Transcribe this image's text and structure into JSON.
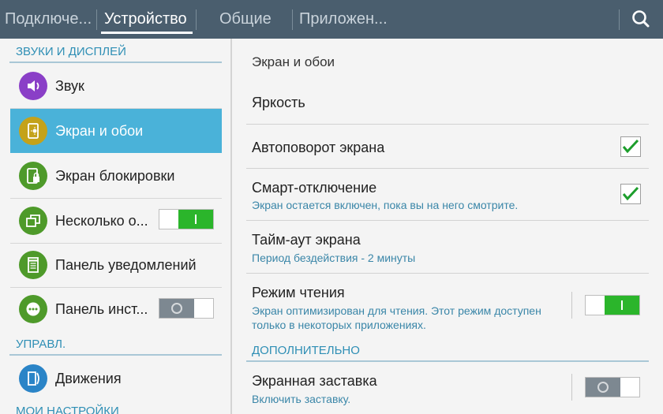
{
  "topbar": {
    "tabs": [
      {
        "label": "Подключе..."
      },
      {
        "label": "Устройство",
        "active": true
      },
      {
        "label": "Общие"
      },
      {
        "label": "Приложен..."
      }
    ],
    "search_icon": "search-icon"
  },
  "sidebar": {
    "sections": [
      {
        "header": "ЗВУКИ И ДИСПЛЕЙ"
      },
      {
        "header": "УПРАВЛ."
      },
      {
        "header": "МОИ НАСТРОЙКИ"
      }
    ],
    "items": [
      {
        "label": "Звук",
        "icon": "speaker-icon",
        "icon_color": "#8a3fc7"
      },
      {
        "label": "Экран и обои",
        "icon": "screen-brightness-icon",
        "icon_color": "#c4a21a",
        "selected": true
      },
      {
        "label": "Экран блокировки",
        "icon": "lock-screen-icon",
        "icon_color": "#4e9a2a"
      },
      {
        "label": "Несколько о...",
        "icon": "multi-window-icon",
        "icon_color": "#4e9a2a",
        "toggle": "on"
      },
      {
        "label": "Панель уведомлений",
        "icon": "notification-panel-icon",
        "icon_color": "#4e9a2a"
      },
      {
        "label": "Панель инст...",
        "icon": "toolbox-icon",
        "icon_color": "#4e9a2a",
        "toggle": "off"
      },
      {
        "label": "Движения",
        "icon": "motion-icon",
        "icon_color": "#2a84c7"
      }
    ]
  },
  "main": {
    "title": "Экран и обои",
    "rows": [
      {
        "label": "Яркость"
      },
      {
        "label": "Автоповорот экрана",
        "checked": true
      },
      {
        "label": "Смарт-отключение",
        "sub": "Экран остается включен, пока вы на него смотрите.",
        "checked": true
      },
      {
        "label": "Тайм-аут экрана",
        "sub": "Период бездействия - 2 минуты"
      },
      {
        "label": "Режим чтения",
        "sub": "Экран оптимизирован для чтения. Этот режим доступен только в некоторых приложениях.",
        "toggle": "on"
      },
      {
        "label": "Экранная заставка",
        "sub": "Включить заставку.",
        "toggle": "off"
      }
    ],
    "section_header": "ДОПОЛНИТЕЛЬНО"
  },
  "colors": {
    "topbar": "#4a5e6e",
    "selected": "#4ab2d9",
    "accent": "#2f8fb5",
    "toggle_on": "#2bb52b",
    "toggle_off": "#7d8891",
    "checkmark": "#1d9e2c"
  }
}
